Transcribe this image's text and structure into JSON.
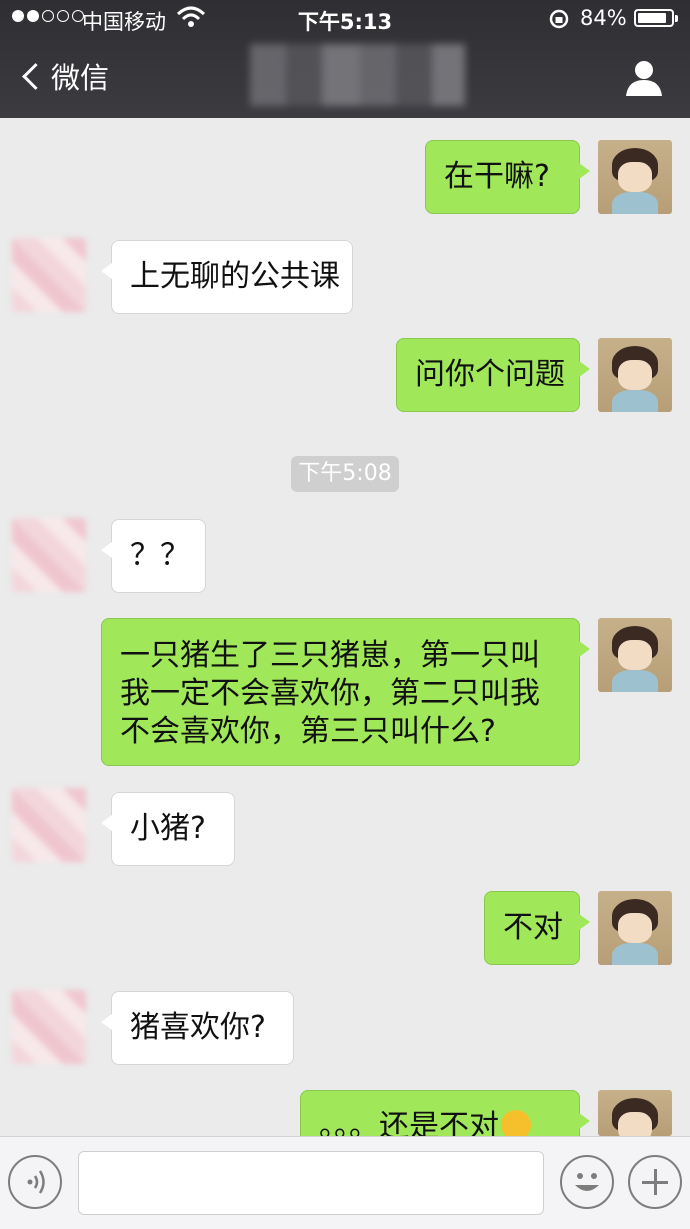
{
  "status_bar": {
    "carrier": "中国移动",
    "time": "下午5:13",
    "battery_percent": "84%",
    "signal_bars_filled": 2,
    "signal_bars_total": 5
  },
  "nav": {
    "back_label": "微信",
    "profile_icon": "person-icon"
  },
  "messages": [
    {
      "from": "me",
      "text": "在干嘛?"
    },
    {
      "from": "them",
      "text": "上无聊的公共课"
    },
    {
      "from": "me",
      "text": "问你个问题"
    },
    {
      "from": "me",
      "text": "一只猪生了三只猪崽，第一只叫我一定不会喜欢你，第二只叫我不会喜欢你，第三只叫什么?"
    },
    {
      "from": "them",
      "text": "？？"
    },
    {
      "from": "them",
      "text": "小猪?"
    },
    {
      "from": "me",
      "text": "不对"
    },
    {
      "from": "them",
      "text": "猪喜欢你?"
    },
    {
      "from": "me",
      "text": "。。。还是不对"
    }
  ],
  "timestamp": "下午5:08",
  "input_bar": {
    "voice_icon": "voice-icon",
    "emoji_icon": "smiley-icon",
    "plus_icon": "plus-icon"
  },
  "colors": {
    "nav_bg": "#36363a",
    "my_bubble": "#a0e75a",
    "their_bubble": "#ffffff",
    "chat_bg": "#ebebeb"
  }
}
